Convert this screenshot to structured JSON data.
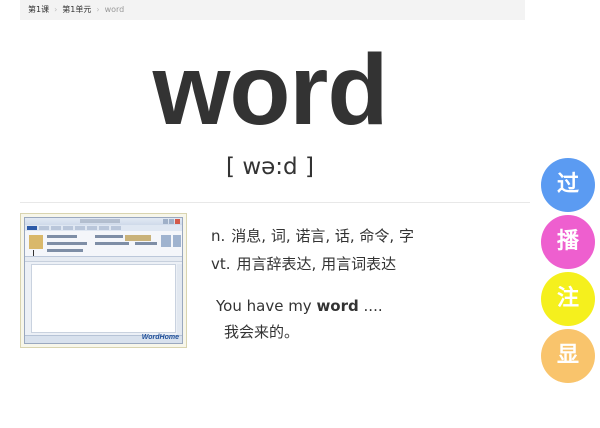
{
  "breadcrumb": {
    "lesson": "第1课",
    "unit": "第1单元",
    "current": "word"
  },
  "entry": {
    "word": "word",
    "phonetic": "[ wə:d ]"
  },
  "definitions": [
    {
      "pos": "n.",
      "meaning": "消息, 词, 诺言, 话, 命令, 字"
    },
    {
      "pos": "vt.",
      "meaning": "用言辞表达, 用言词表达"
    }
  ],
  "example": {
    "en_before": "You have my ",
    "en_word": "word",
    "en_after": " ....",
    "zh": "我会来的。"
  },
  "thumbnail": {
    "brand": "WordHome"
  },
  "side_buttons": [
    {
      "label": "过",
      "color": "#5b9bf2"
    },
    {
      "label": "播",
      "color": "#ee5fcf"
    },
    {
      "label": "注",
      "color": "#f5f01d"
    },
    {
      "label": "显",
      "color": "#f9c46c"
    }
  ]
}
